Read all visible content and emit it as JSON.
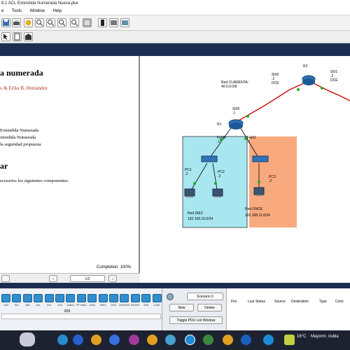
{
  "window": {
    "title": "8.1 ACL Extendida Numerada Nueva.pka"
  },
  "menu": {
    "items": [
      "e",
      "Tools",
      "Window",
      "Help"
    ]
  },
  "document": {
    "heading": "a numerada",
    "authors": "o & Erika B. Hernández",
    "list": [
      "Extendida Numerada",
      "xtendida Numerada",
      "la seguridad propuesta"
    ],
    "subheading": "ar",
    "paragraph": "ecesarios los siguientes componentes:",
    "completion": "Completion: 100%",
    "page": "1/2"
  },
  "topology": {
    "red_cuarenta": "Red CUARENTA:\n40.0.0.0/8",
    "r2_label": "R2",
    "r2_left_port": "S0/0\n.2\nDCE",
    "r2_right_port": "S0/1\n.2\nDCE",
    "r1_label": "R1",
    "r1_port_s": "S0/0\n.1",
    "r1_fa00": "Fa0/0\n.1",
    "r1_fa01": "Fa0/1\n.1",
    "pc1": "PC1\n.2",
    "pc2": "PC2\n.3",
    "pc3": "PC3\n.2",
    "red_diez_title": "Red DIEZ",
    "red_diez_net": "192.168.10.0/24",
    "red_once_title": "Red ONCE",
    "red_once_net": "192.168.11.0/24"
  },
  "devices": {
    "labels": [
      "2x5",
      "3x1",
      "3x8",
      "4x1",
      "4x2",
      "2x3",
      "4x8x1",
      "PT-Ham",
      "1941",
      "2901",
      "2911",
      "819HGW",
      "819HG",
      "829",
      "1240"
    ],
    "bottom_label": "829"
  },
  "scenario": {
    "name": "Scenario 0",
    "new": "New",
    "delete": "Delete",
    "toggle": "Toggle PDU List Window"
  },
  "pdu": {
    "columns": [
      "Fire",
      "Last Status",
      "Source",
      "Destination",
      "Type",
      "Color"
    ]
  },
  "taskbar": {
    "weather": "16°C",
    "weather_desc": "Mayorm. nubla"
  },
  "colors": {
    "cyan_net": "#a8e6f0",
    "orange_net": "#f9a97e",
    "serial": "#d01010",
    "ethernet": "#22aa22",
    "blue_bar": "#1b2e52"
  }
}
